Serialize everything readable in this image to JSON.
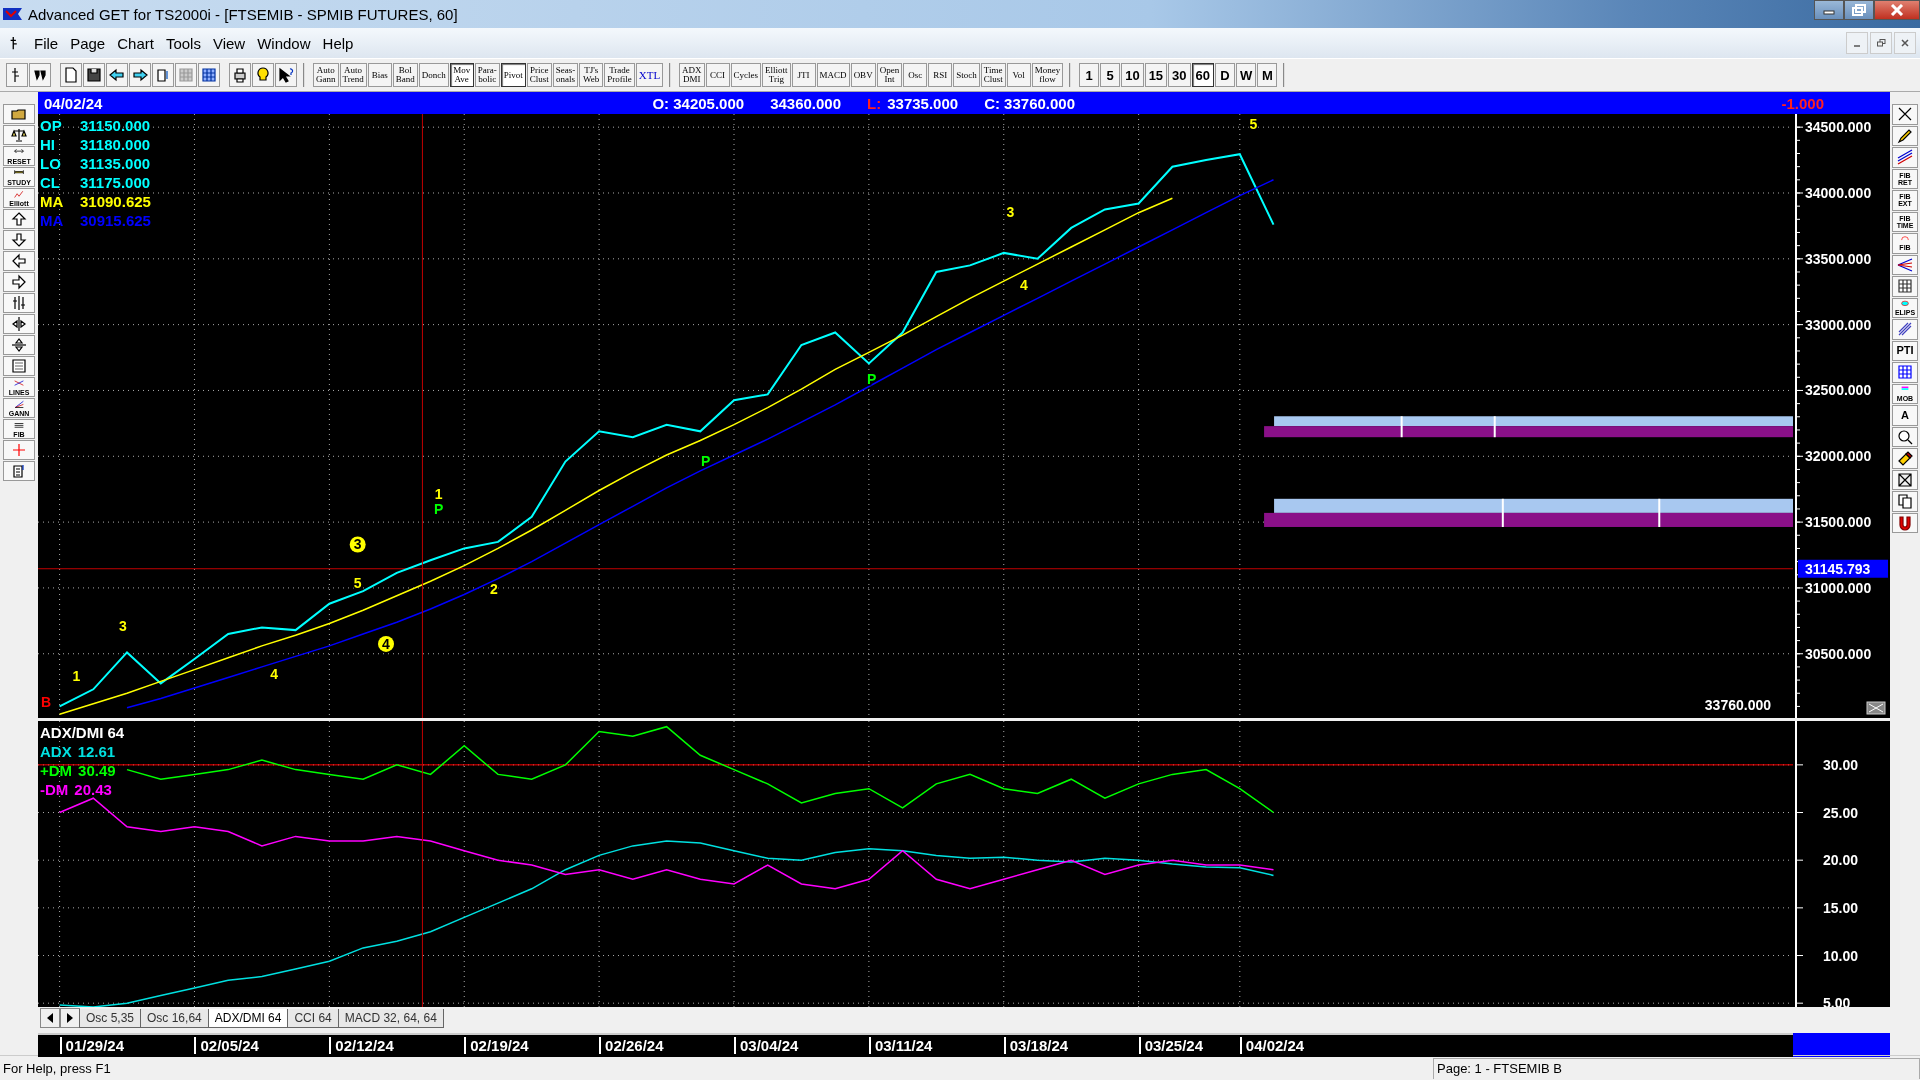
{
  "window": {
    "title": "Advanced GET for TS2000i - [FTSEMIB - SPMIB FUTURES, 60]"
  },
  "menu": [
    "File",
    "Page",
    "Chart",
    "Tools",
    "View",
    "Window",
    "Help"
  ],
  "toolbar": {
    "icon_buttons": [
      {
        "kind": "pointer"
      },
      {
        "kind": "quote"
      },
      {
        "kind": "new-page"
      },
      {
        "kind": "save"
      },
      {
        "kind": "page-left"
      },
      {
        "kind": "page-right"
      },
      {
        "kind": "page-cycle"
      },
      {
        "kind": "grid-disabled"
      },
      {
        "kind": "grid-color"
      },
      {
        "kind": "print"
      },
      {
        "kind": "bulb"
      },
      {
        "kind": "help-pointer"
      }
    ],
    "study_buttons": [
      {
        "lines": [
          "Auto",
          "Gann"
        ],
        "pressed": false
      },
      {
        "lines": [
          "Auto",
          "Trend"
        ],
        "pressed": false
      },
      {
        "lines": [
          "Bias"
        ],
        "pressed": false
      },
      {
        "lines": [
          "Bol",
          "Band"
        ],
        "pressed": false
      },
      {
        "lines": [
          "Donch"
        ],
        "pressed": false
      },
      {
        "lines": [
          "Mov",
          "Ave"
        ],
        "pressed": true
      },
      {
        "lines": [
          "Para-",
          "bolic"
        ],
        "pressed": false
      },
      {
        "lines": [
          "Pivot"
        ],
        "pressed": true
      },
      {
        "lines": [
          "Price",
          "Clust"
        ],
        "pressed": false
      },
      {
        "lines": [
          "Seas-",
          "onals"
        ],
        "pressed": false
      },
      {
        "lines": [
          "TJ's",
          "Web"
        ],
        "pressed": false
      },
      {
        "lines": [
          "Trade",
          "Profile"
        ],
        "pressed": false
      },
      {
        "lines": [
          "XTL"
        ],
        "pressed": false
      }
    ],
    "indicator_buttons": [
      {
        "lines": [
          "ADX",
          "DMI"
        ],
        "pressed": false
      },
      {
        "lines": [
          "CCI"
        ],
        "pressed": false
      },
      {
        "lines": [
          "Cycles"
        ],
        "pressed": false
      },
      {
        "lines": [
          "Elliott",
          "Trig"
        ],
        "pressed": false
      },
      {
        "lines": [
          "JTI"
        ],
        "pressed": false
      },
      {
        "lines": [
          "MACD"
        ],
        "pressed": false
      },
      {
        "lines": [
          "OBV"
        ],
        "pressed": false
      },
      {
        "lines": [
          "Open",
          "Int"
        ],
        "pressed": false
      },
      {
        "lines": [
          "Osc"
        ],
        "pressed": false
      },
      {
        "lines": [
          "RSI"
        ],
        "pressed": false
      },
      {
        "lines": [
          "Stoch"
        ],
        "pressed": false
      },
      {
        "lines": [
          "Time",
          "Clust"
        ],
        "pressed": false
      },
      {
        "lines": [
          "Vol"
        ],
        "pressed": false
      },
      {
        "lines": [
          "Money",
          "flow"
        ],
        "pressed": false
      }
    ],
    "interval_buttons": [
      {
        "label": "1",
        "selected": false
      },
      {
        "label": "5",
        "selected": false
      },
      {
        "label": "10",
        "selected": false
      },
      {
        "label": "15",
        "selected": false
      },
      {
        "label": "30",
        "selected": false
      },
      {
        "label": "60",
        "selected": true
      },
      {
        "label": "D",
        "selected": false
      },
      {
        "label": "W",
        "selected": false
      },
      {
        "label": "M",
        "selected": false
      }
    ]
  },
  "left_tools": [
    {
      "kind": "open-folder"
    },
    {
      "kind": "scales"
    },
    {
      "kind": "reset",
      "label": "RESET"
    },
    {
      "kind": "study",
      "label": "STUDY"
    },
    {
      "kind": "elliott",
      "label": "Elliott"
    },
    {
      "kind": "arrow-up"
    },
    {
      "kind": "arrow-down"
    },
    {
      "kind": "arrow-left"
    },
    {
      "kind": "arrow-right"
    },
    {
      "kind": "split-vertical"
    },
    {
      "kind": "expand-horizontal"
    },
    {
      "kind": "expand-vertical"
    },
    {
      "kind": "dot-grid"
    },
    {
      "kind": "lines",
      "label": "LINES"
    },
    {
      "kind": "gann",
      "label": "GANN"
    },
    {
      "kind": "fib",
      "label": "FIB"
    },
    {
      "kind": "crosshair"
    },
    {
      "kind": "settings-sheet"
    }
  ],
  "right_tools": [
    {
      "kind": "close-x"
    },
    {
      "kind": "pencil"
    },
    {
      "kind": "parallel-lines"
    },
    {
      "kind": "text",
      "lines": [
        "FIB",
        "RET"
      ]
    },
    {
      "kind": "text",
      "lines": [
        "FIB",
        "EXT"
      ]
    },
    {
      "kind": "text",
      "lines": [
        "FIB",
        "TIME"
      ]
    },
    {
      "kind": "fib-arc",
      "lines": [
        "FIB"
      ]
    },
    {
      "kind": "fan"
    },
    {
      "kind": "grid"
    },
    {
      "kind": "ellipse",
      "lines": [
        "ELIPS"
      ]
    },
    {
      "kind": "parallel-diag"
    },
    {
      "kind": "text",
      "lines": [
        "PTI"
      ]
    },
    {
      "kind": "blue-grid"
    },
    {
      "kind": "mob",
      "lines": [
        "MOB"
      ]
    },
    {
      "kind": "text",
      "lines": [
        "A"
      ]
    },
    {
      "kind": "zoom"
    },
    {
      "kind": "eraser"
    },
    {
      "kind": "pattern"
    },
    {
      "kind": "copy"
    },
    {
      "kind": "magnet"
    }
  ],
  "quote_bar": {
    "date": "04/02/24",
    "items": [
      {
        "text": "O: 34205.000"
      },
      {
        "text": "34360.000"
      },
      {
        "label": "L:",
        "text": "33735.000"
      },
      {
        "text": "C: 33760.000"
      }
    ],
    "change": "-1.000"
  },
  "price_chart": {
    "legend": [
      {
        "label": "OP",
        "value": "31150.000",
        "color": "#00ffff"
      },
      {
        "label": "HI",
        "value": "31180.000",
        "color": "#00ffff"
      },
      {
        "label": "LO",
        "value": "31135.000",
        "color": "#00ffff"
      },
      {
        "label": "CL",
        "value": "31175.000",
        "color": "#00ffff"
      },
      {
        "label": "MA",
        "value": "31090.625",
        "color": "#ffff00"
      },
      {
        "label": "MA",
        "value": "30915.625",
        "color": "#0000ff"
      }
    ],
    "last_price": "33760.000",
    "wave_labels": [
      {
        "text": "B",
        "color": "#ff0000",
        "circled": false
      },
      {
        "text": "1",
        "color": "#ffff00",
        "circled": false
      },
      {
        "text": "3",
        "color": "#ffff00",
        "circled": false
      },
      {
        "text": "4",
        "color": "#ffff00",
        "circled": false
      },
      {
        "text": "3",
        "color": "#ffff00",
        "circled": true
      },
      {
        "text": "5",
        "color": "#ffff00",
        "circled": false
      },
      {
        "text": "4",
        "color": "#ffff00",
        "circled": true
      },
      {
        "text": "1",
        "color": "#ffff00",
        "circled": false
      },
      {
        "text": "P",
        "color": "#00ff00",
        "circled": false
      },
      {
        "text": "2",
        "color": "#ffff00",
        "circled": false
      },
      {
        "text": "P",
        "color": "#00ff00",
        "circled": false
      },
      {
        "text": "P",
        "color": "#00ff00",
        "circled": false
      },
      {
        "text": "3",
        "color": "#ffff00",
        "circled": false
      },
      {
        "text": "4",
        "color": "#ffff00",
        "circled": false
      },
      {
        "text": "5",
        "color": "#ffff00",
        "circled": false
      }
    ],
    "chart_data": {
      "type": "line",
      "grid": true,
      "series": [
        {
          "color": "#00ffff",
          "values": [
            30100,
            30230,
            30510,
            30275,
            30460,
            30650,
            30700,
            30680,
            30880,
            30975,
            31115,
            31210,
            31300,
            31350,
            31540,
            31960,
            32190,
            32145,
            32240,
            32190,
            32425,
            32470,
            32845,
            32940,
            32705,
            32940,
            33400,
            33450,
            33545,
            33500,
            33735,
            33875,
            33920,
            34200,
            34250,
            34295,
            33760
          ]
        },
        {
          "color": "#ffff00",
          "values": [
            30040,
            30120,
            30200,
            30290,
            30380,
            30470,
            30560,
            30640,
            30730,
            30830,
            30940,
            31050,
            31170,
            31300,
            31440,
            31590,
            31740,
            31880,
            32010,
            32120,
            32240,
            32370,
            32510,
            32660,
            32790,
            32920,
            33060,
            33200,
            33330,
            33460,
            33590,
            33720,
            33850,
            33960,
            null,
            null,
            null
          ]
        },
        {
          "color": "#0000ff",
          "values": [
            null,
            null,
            30090,
            30160,
            30240,
            30320,
            30400,
            30480,
            30560,
            30650,
            30740,
            30840,
            30950,
            31070,
            31200,
            31340,
            31480,
            31620,
            31760,
            31890,
            32010,
            32130,
            32260,
            32390,
            32530,
            32670,
            32810,
            32940,
            33070,
            33200,
            33330,
            33460,
            33590,
            33720,
            33850,
            33980,
            34100
          ]
        }
      ],
      "ylim": [
        30012,
        34600
      ],
      "yticks": [
        {
          "value": 34500,
          "label": "34500.000"
        },
        {
          "value": 34000,
          "label": "34000.000"
        },
        {
          "value": 33500,
          "label": "33500.000"
        },
        {
          "value": 33000,
          "label": "33000.000"
        },
        {
          "value": 32500,
          "label": "32500.000"
        },
        {
          "value": 32000,
          "label": "32000.000"
        },
        {
          "value": 31500,
          "label": "31500.000"
        },
        {
          "value": 31000,
          "label": "31000.000"
        },
        {
          "value": 30500,
          "label": "30500.000"
        }
      ],
      "ref_lines": [
        {
          "axis": "y",
          "value": 31145.793,
          "label": "31145.793"
        }
      ]
    }
  },
  "indicator": {
    "readings": [
      "12.61",
      "30.49",
      "20.43"
    ],
    "chart_data": {
      "type": "line",
      "title": "ADX/DMI 64",
      "grid": true,
      "series": [
        {
          "name": "ADX",
          "color": "#00e0e0",
          "values": [
            4.8,
            4.6,
            5,
            5.8,
            6.6,
            7.4,
            7.8,
            8.6,
            9.4,
            10.8,
            11.5,
            12.5,
            14,
            15.5,
            17,
            19,
            20.5,
            21.5,
            22,
            21.8,
            21,
            20.2,
            20,
            20.8,
            21.2,
            21,
            20.5,
            20.2,
            20.3,
            20,
            19.8,
            20.2,
            20,
            19.6,
            19.3,
            19.2,
            18.4
          ]
        },
        {
          "name": "+DM",
          "color": "#00ff00",
          "values": [
            null,
            null,
            29.5,
            28.5,
            29,
            29.5,
            30.5,
            29.5,
            29,
            28.5,
            30,
            29,
            32,
            29,
            28.5,
            30,
            33.5,
            33,
            34,
            31,
            29.5,
            28,
            26,
            27,
            27.5,
            25.5,
            28,
            29,
            27.5,
            27,
            28.5,
            26.5,
            28,
            29,
            29.5,
            27.5,
            25
          ]
        },
        {
          "name": "-DM",
          "color": "#ff00ff",
          "values": [
            25,
            26.5,
            23.5,
            23,
            23.5,
            23,
            21.5,
            22.5,
            22,
            22,
            22.5,
            22,
            21,
            20,
            19.5,
            18.5,
            19,
            18,
            19,
            18,
            17.5,
            19.5,
            17.5,
            17,
            18,
            21,
            18,
            17,
            18,
            19,
            20,
            18.5,
            19.5,
            20,
            19.5,
            19.5,
            19
          ]
        }
      ],
      "ylim": [
        4.6,
        34.6
      ],
      "yticks": [
        {
          "value": 30,
          "label": "30.00"
        },
        {
          "value": 25,
          "label": "25.00"
        },
        {
          "value": 20,
          "label": "20.00"
        },
        {
          "value": 15,
          "label": "15.00"
        },
        {
          "value": 10,
          "label": "10.00"
        },
        {
          "value": 5,
          "label": "5.00"
        }
      ],
      "ref_lines": [
        {
          "axis": "y",
          "value": 30
        }
      ]
    }
  },
  "indicator_tabs": [
    {
      "label": "Osc 5,35",
      "selected": false
    },
    {
      "label": "Osc 16,64",
      "selected": false
    },
    {
      "label": "ADX/DMI 64",
      "selected": true
    },
    {
      "label": "CCI 64",
      "selected": false
    },
    {
      "label": "MACD 32, 64, 64",
      "selected": false
    }
  ],
  "date_axis": [
    "01/29/24",
    "02/05/24",
    "02/12/24",
    "02/19/24",
    "02/26/24",
    "03/04/24",
    "03/11/24",
    "03/18/24",
    "03/25/24",
    "04/02/24"
  ],
  "status_bar": {
    "help": "For Help, press F1",
    "page": "Page: 1 - FTSEMIB B"
  }
}
